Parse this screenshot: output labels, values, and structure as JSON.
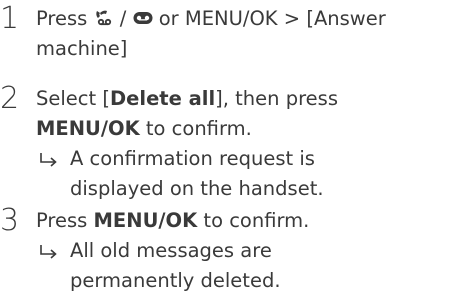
{
  "steps": [
    {
      "number": "1",
      "line1_press": "Press",
      "line1_sep": "/",
      "line1_or": "or",
      "line1_menu": "MENU/OK",
      "line1_gt": ">",
      "line1_bracket": "[Answer",
      "line2": "machine]",
      "icons": [
        "answer-machine-handset-icon",
        "voicemail-icon"
      ]
    },
    {
      "number": "2",
      "line1_pre": "Select [",
      "line1_bold": "Delete all",
      "line1_post": "], then press",
      "line2_bold": "MENU/OK",
      "line2_post": " to confirm.",
      "result_line1": "A confirmation request is",
      "result_line2": "displayed on the handset."
    },
    {
      "number": "3",
      "line1_pre": "Press ",
      "line1_bold": "MENU/OK",
      "line1_post": " to confirm.",
      "result_line1": "All old messages are",
      "result_line2": "permanently deleted."
    }
  ],
  "colors": {
    "text": "#3a3a3a"
  }
}
